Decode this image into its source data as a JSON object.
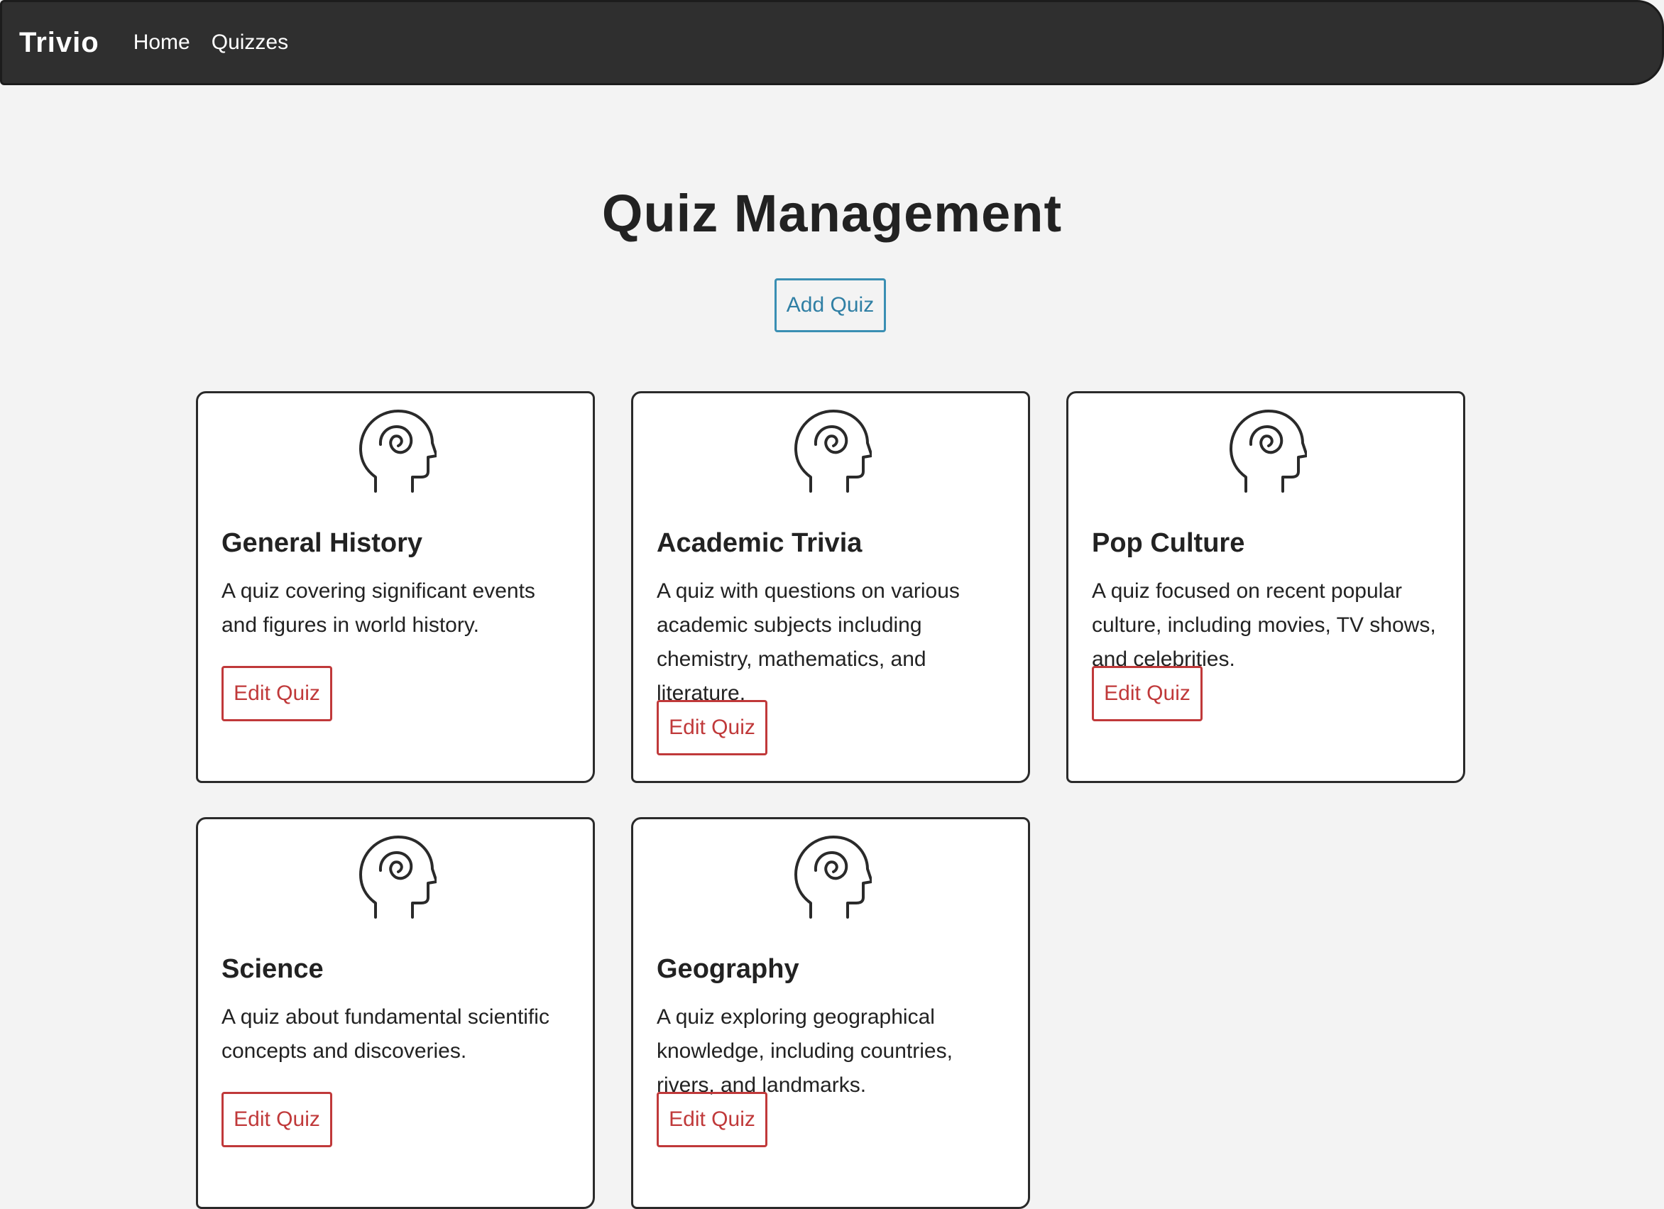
{
  "navbar": {
    "brand": "Trivio",
    "links": [
      "Home",
      "Quizzes"
    ]
  },
  "page": {
    "title": "Quiz Management",
    "add_button": "Add Quiz"
  },
  "quizzes": [
    {
      "title": "General History",
      "description": "A quiz covering significant events and figures in world history.",
      "edit_label": "Edit Quiz",
      "icon": "head-spiral-icon"
    },
    {
      "title": "Academic Trivia",
      "description": "A quiz with questions on various academic subjects including chemistry, mathematics, and literature.",
      "edit_label": "Edit Quiz",
      "icon": "head-spiral-icon"
    },
    {
      "title": "Pop Culture",
      "description": "A quiz focused on recent popular culture, including movies, TV shows, and celebrities.",
      "edit_label": "Edit Quiz",
      "icon": "head-spiral-icon"
    },
    {
      "title": "Science",
      "description": "A quiz about fundamental scientific concepts and discoveries.",
      "edit_label": "Edit Quiz",
      "icon": "head-spiral-icon"
    },
    {
      "title": "Geography",
      "description": "A quiz exploring geographical knowledge, including countries, rivers, and landmarks.",
      "edit_label": "Edit Quiz",
      "icon": "head-spiral-icon"
    }
  ],
  "colors": {
    "navbar_bg": "#2f2f2f",
    "page_bg": "#f3f3f3",
    "add_button": "#3a8fb3",
    "edit_button": "#c0393a"
  }
}
